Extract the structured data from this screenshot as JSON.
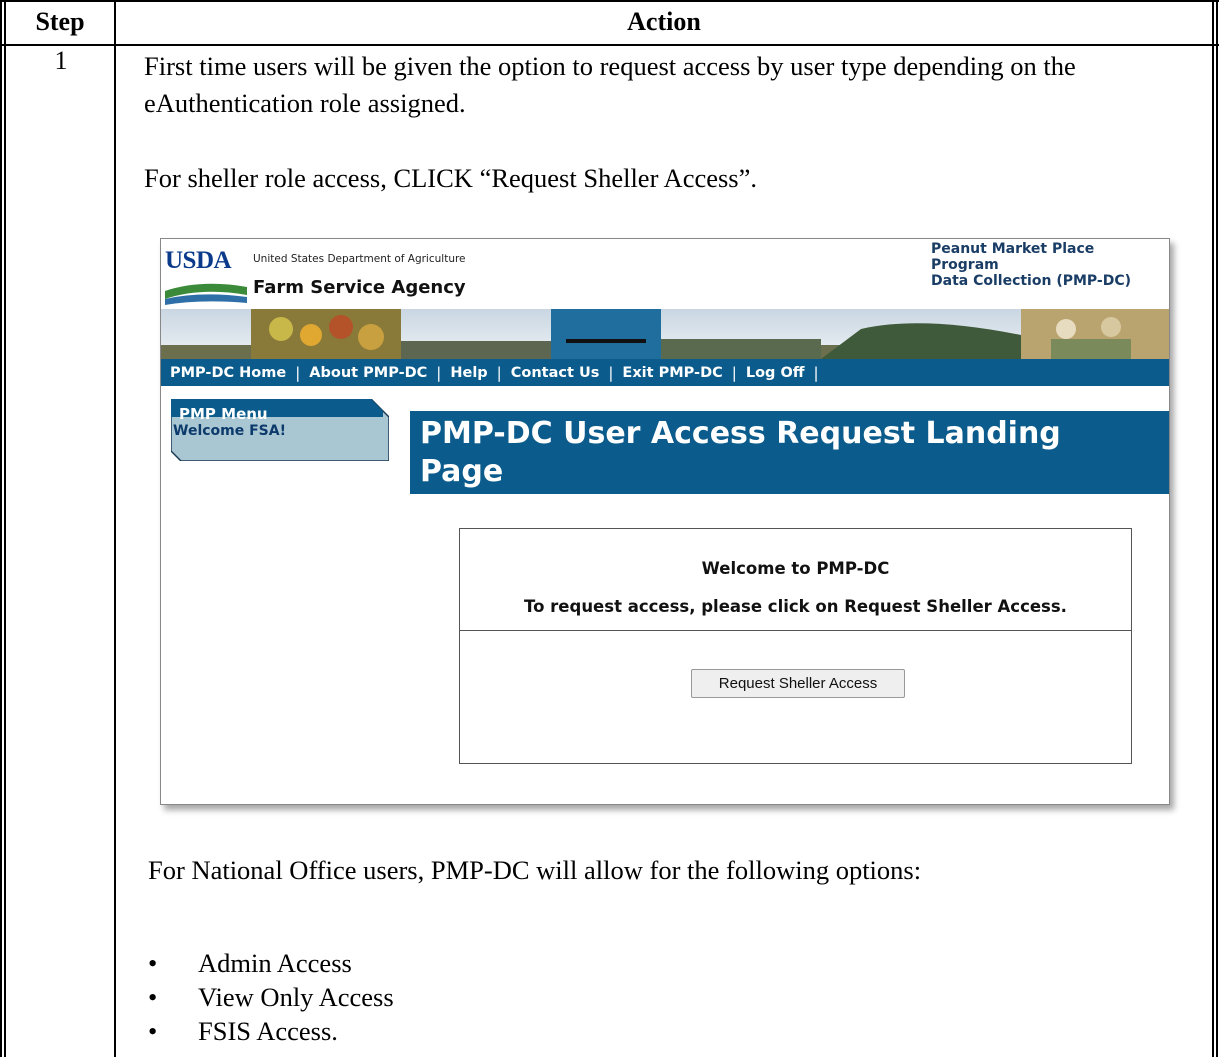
{
  "table": {
    "header_step": "Step",
    "header_action": "Action",
    "step_number": "1",
    "intro_paragraph": "First time users will be given the option to request access by user type depending on the eAuthentication role assigned.",
    "sheller_instruction": "For sheller role access, CLICK “Request Sheller Access”.",
    "national_office_intro": "For National Office users, PMP-DC will allow for the following options:",
    "options": [
      "Admin Access",
      "View Only Access",
      "FSIS Access."
    ]
  },
  "screenshot": {
    "logo_text": "USDA",
    "department": "United States Department of Agriculture",
    "agency": "Farm Service Agency",
    "program_lines": [
      "Peanut Market Place",
      "Program",
      "Data Collection (PMP-DC)"
    ],
    "nav_items": [
      "PMP-DC Home",
      "About PMP-DC",
      "Help",
      "Contact Us",
      "Exit PMP-DC",
      "Log Off"
    ],
    "menu_title": "PMP Menu",
    "menu_welcome": "Welcome FSA!",
    "page_title_line1": "PMP-DC User Access Request Landing",
    "page_title_line2": "Page",
    "welcome_title": "Welcome to PMP-DC",
    "welcome_text": "To request access, please click on Request Sheller Access.",
    "request_button_label": "Request Sheller Access"
  },
  "colors": {
    "nav_blue": "#0b5c8c",
    "logo_blue": "#0b3a8a",
    "logo_green": "#3a8a3a",
    "menu_tab": "#0b5c8c",
    "menu_body": "#a9c6d3"
  }
}
